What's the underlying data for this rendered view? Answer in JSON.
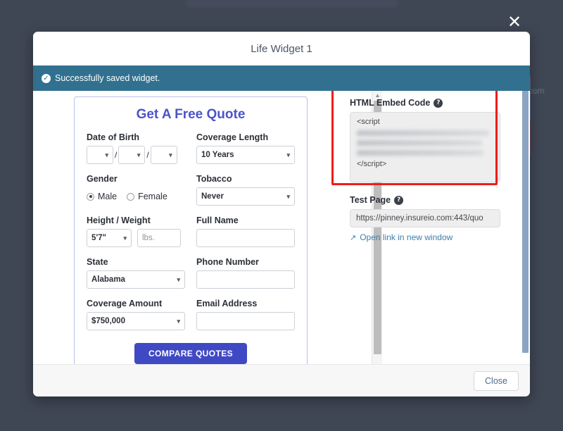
{
  "background": {
    "ghost_text_right": "o.com"
  },
  "modal": {
    "close_x_icon": "close-icon",
    "title": "Life Widget 1",
    "alert": {
      "icon": "check-circle-icon",
      "message": "Successfully saved widget."
    },
    "footer": {
      "close_label": "Close"
    }
  },
  "preview": {
    "heading": "Get A Free Quote",
    "fields": {
      "date_of_birth": {
        "label": "Date of Birth",
        "month_value": "",
        "day_value": "",
        "year_value": "",
        "separator": "/"
      },
      "coverage_length": {
        "label": "Coverage Length",
        "value": "10 Years"
      },
      "gender": {
        "label": "Gender",
        "options": [
          "Male",
          "Female"
        ],
        "selected": "Male"
      },
      "tobacco": {
        "label": "Tobacco",
        "value": "Never"
      },
      "height_weight": {
        "label": "Height / Weight",
        "height_value": "5'7\"",
        "weight_placeholder": "lbs.",
        "weight_value": ""
      },
      "full_name": {
        "label": "Full Name",
        "value": ""
      },
      "state": {
        "label": "State",
        "value": "Alabama"
      },
      "phone_number": {
        "label": "Phone Number",
        "value": ""
      },
      "coverage_amount": {
        "label": "Coverage Amount",
        "value": "$750,000"
      },
      "email_address": {
        "label": "Email Address",
        "value": ""
      }
    },
    "submit_label": "COMPARE QUOTES"
  },
  "embed": {
    "html_embed_code": {
      "label": "HTML Embed Code",
      "help_icon": "question-mark-icon",
      "code_first_line": "<script",
      "code_last_line": "</script>",
      "redacted_lines": 3
    },
    "test_page": {
      "label": "Test Page",
      "help_icon": "question-mark-icon",
      "url": "https://pinney.insureio.com:443/quo",
      "open_link_label": "Open link in new window",
      "open_link_icon": "external-link-icon"
    }
  },
  "colors": {
    "overlay": "#3f4654",
    "alert_bg": "#31708f",
    "brand_blue": "#4b54c9",
    "cta_blue": "#4049c4",
    "annotation_red": "#ee1c18",
    "link_blue": "#3b7fa8"
  }
}
